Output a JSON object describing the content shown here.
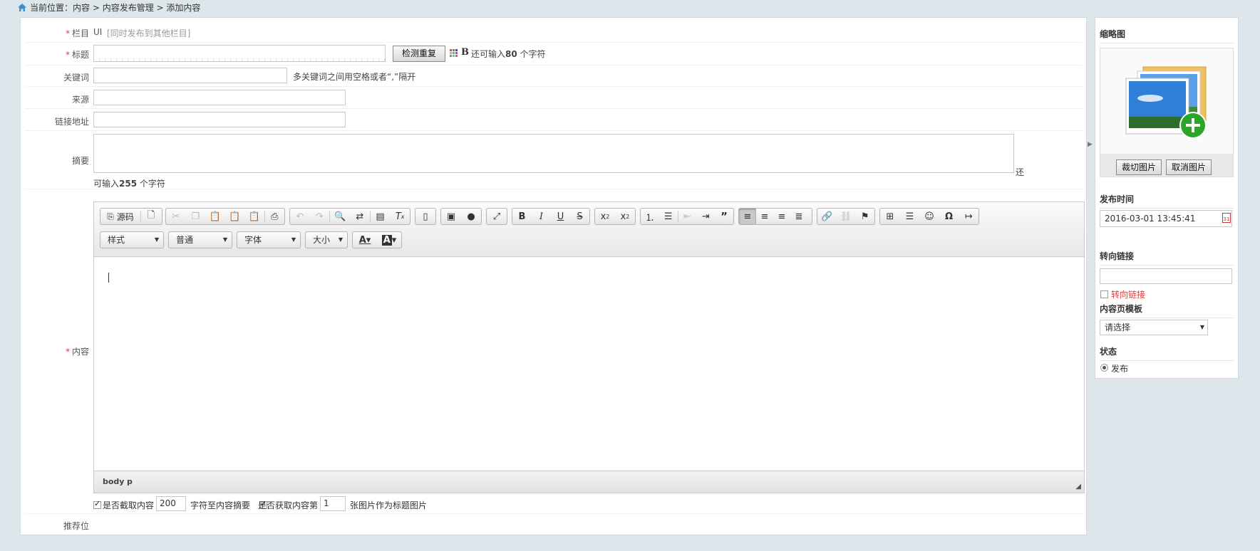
{
  "breadcrumb": {
    "label": "当前位置：",
    "path": "内容 > 内容发布管理 > 添加内容"
  },
  "form": {
    "column": {
      "label": "栏目",
      "value": "UI",
      "sync_link": "[同时发布到其他栏目]"
    },
    "title": {
      "label": "标题",
      "check_button": "检测重复",
      "remain_prefix": "还可输入",
      "remain_count": "80",
      "remain_suffix": "个字符"
    },
    "keywords": {
      "label": "关键词",
      "hint": "多关键词之间用空格或者“,”隔开"
    },
    "source": {
      "label": "来源"
    },
    "link": {
      "label": "链接地址"
    },
    "summary": {
      "label": "摘要",
      "remain_tail": "还",
      "remain_prefix": "可输入",
      "remain_count": "255",
      "remain_suffix": "个字符"
    },
    "content": {
      "label": "内容"
    },
    "recommend": {
      "label": "推荐位"
    }
  },
  "editor": {
    "source_label": "源码",
    "combos": {
      "style": "样式",
      "format": "普通",
      "font": "字体",
      "size": "大小"
    },
    "path": [
      "body",
      "p"
    ]
  },
  "options": {
    "cut_label": "是否截取内容",
    "cut_value": "200",
    "cut_suffix": "字符至内容摘要",
    "img_label": "是否获取内容第",
    "img_value": "1",
    "img_suffix": "张图片作为标题图片"
  },
  "side": {
    "thumb": {
      "heading": "缩略图",
      "crop": "裁切图片",
      "cancel": "取消图片"
    },
    "publish": {
      "heading": "发布时间",
      "value": "2016-03-01 13:45:41"
    },
    "redirect": {
      "heading": "转向链接",
      "checkbox_label": "转向链接"
    },
    "template": {
      "heading": "内容页模板",
      "selected": "请选择"
    },
    "status": {
      "heading": "状态",
      "option": "发布"
    }
  },
  "colors": {
    "required": "#e4393c",
    "redirect_text": "#e4393c",
    "page_bg": "#dde6ea"
  }
}
